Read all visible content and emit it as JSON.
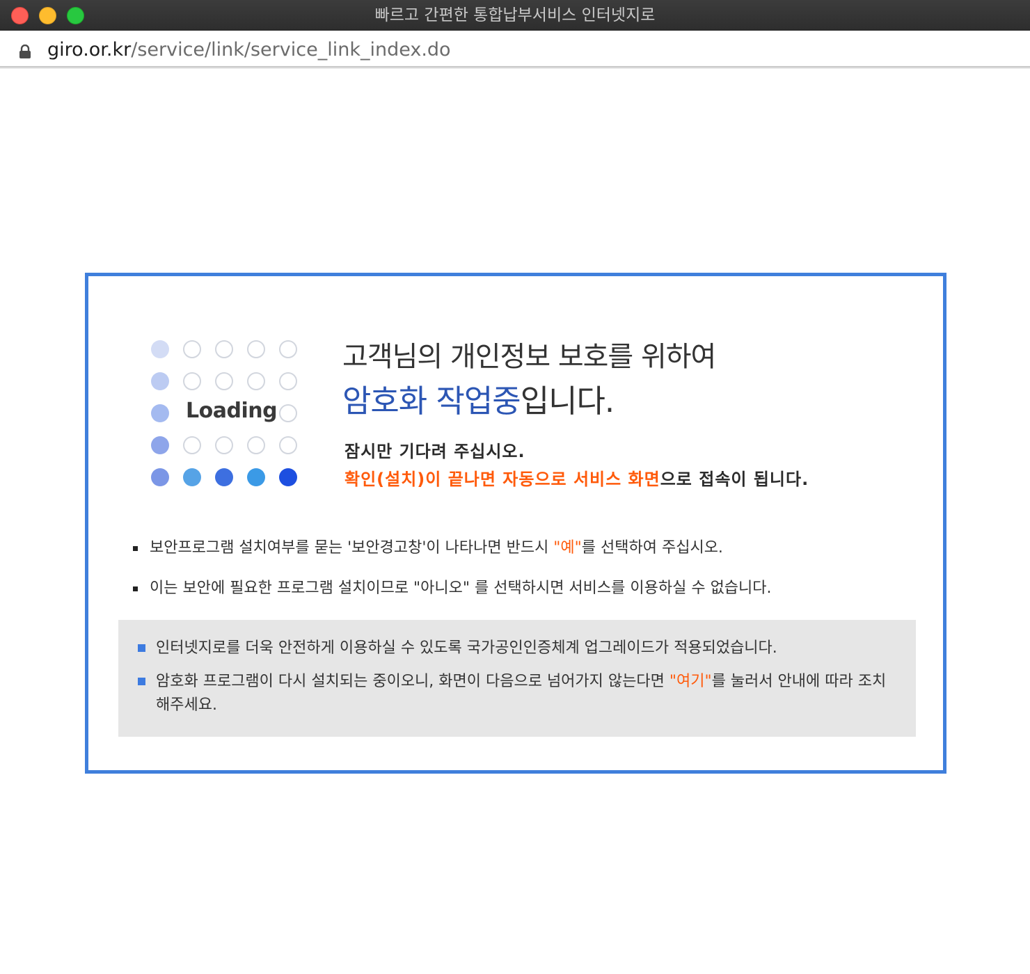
{
  "window": {
    "title": "빠르고 간편한 통합납부서비스 인터넷지로"
  },
  "address_bar": {
    "host": "giro.or.kr",
    "path": "/service/link/service_link_index.do"
  },
  "loader": {
    "label": "Loading"
  },
  "headline": {
    "line1": "고객님의 개인정보 보호를 위하여",
    "line2_highlight": "암호화 작업중",
    "line2_rest": "입니다."
  },
  "notice": {
    "line1": "잠시만 기다려 주십시오.",
    "line2_highlight": "확인(설치)이 끝나면 자동으로 서비스 화면",
    "line2_rest": "으로 접속이 됩니다."
  },
  "bullets": {
    "item1_before": "보안프로그램 설치여부를 묻는 '보안경고창'이 나타나면 반드시 ",
    "item1_highlight": "\"예\"",
    "item1_after": "를 선택하여 주십시오.",
    "item2": "이는 보안에 필요한 프로그램 설치이므로 \"아니오\" 를 선택하시면 서비스를 이용하실 수 없습니다."
  },
  "info_box": {
    "item1": "인터넷지로를 더욱 안전하게 이용하실 수 있도록 국가공인인증체계 업그레이드가 적용되었습니다.",
    "item2_before": "암호화 프로그램이 다시 설치되는 중이오니, 화면이 다음으로 넘어가지 않는다면 ",
    "item2_link": "\"여기\"",
    "item2_after": "를 눌러서 안내에 따라 조치해주세요."
  },
  "colors": {
    "panel_border": "#3f7fdc",
    "accent_orange": "#ff5a0a",
    "accent_blue": "#2c56b4"
  }
}
